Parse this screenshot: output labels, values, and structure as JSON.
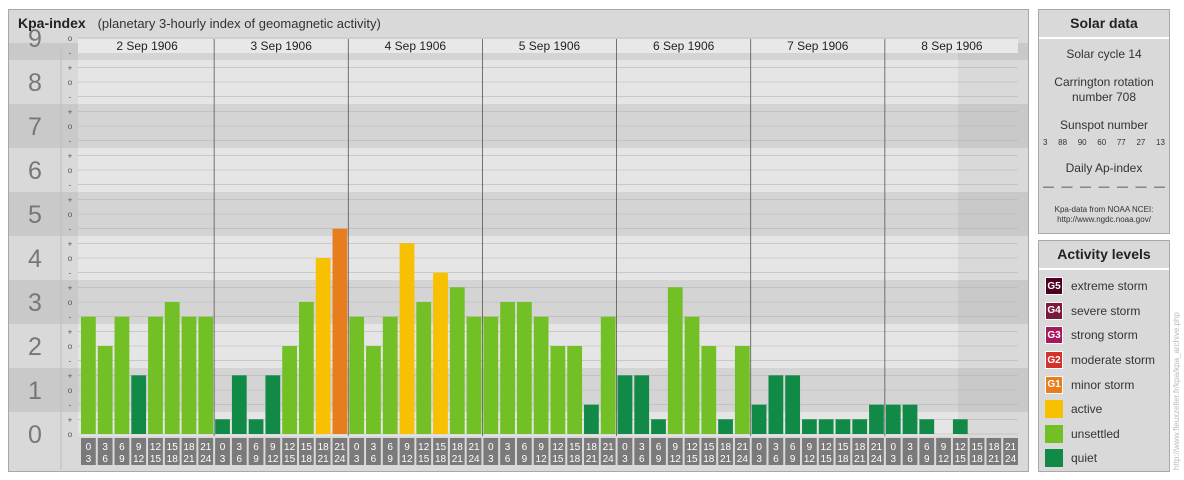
{
  "header": {
    "title": "Kpa-index",
    "subtitle": "(planetary 3-hourly index of geomagnetic activity)"
  },
  "chart_data": {
    "type": "bar",
    "title": "Kpa-index",
    "subtitle": "(planetary 3-hourly index of geomagnetic activity)",
    "ylim": [
      0,
      9
    ],
    "y_ticks": [
      "0",
      "1",
      "2",
      "3",
      "4",
      "5",
      "6",
      "7",
      "8",
      "9"
    ],
    "sub_ticks": [
      "-",
      "o",
      "+"
    ],
    "days": [
      "2 Sep 1906",
      "3 Sep 1906",
      "4 Sep 1906",
      "5 Sep 1906",
      "6 Sep 1906",
      "7 Sep 1906",
      "8 Sep 1906"
    ],
    "interval_starts": [
      "0",
      "3",
      "6",
      "9",
      "12",
      "15",
      "18",
      "21"
    ],
    "interval_ends": [
      "3",
      "6",
      "9",
      "12",
      "15",
      "18",
      "21",
      "24"
    ],
    "values": [
      [
        2.667,
        2.0,
        2.667,
        1.333,
        2.667,
        3.0,
        2.667,
        2.667
      ],
      [
        0.333,
        1.333,
        0.333,
        1.333,
        2.0,
        3.0,
        4.0,
        4.667
      ],
      [
        2.667,
        2.0,
        2.667,
        4.333,
        3.0,
        3.667,
        3.333,
        2.667
      ],
      [
        2.667,
        3.0,
        3.0,
        2.667,
        2.0,
        2.0,
        0.667,
        2.667
      ],
      [
        1.333,
        1.333,
        0.333,
        3.333,
        2.667,
        2.0,
        0.333,
        2.0
      ],
      [
        0.667,
        1.333,
        1.333,
        0.333,
        0.333,
        0.333,
        0.333,
        0.667
      ],
      [
        0.667,
        0.667,
        0.333,
        0.0,
        0.333,
        0.0,
        0.0,
        0.0
      ]
    ],
    "grid": true
  },
  "colors": {
    "extreme": "#4d0022",
    "severe": "#7a1a3f",
    "strong": "#a6195c",
    "moderate": "#d2312c",
    "minor": "#e87d1e",
    "active": "#f7c000",
    "unsettled": "#73bf26",
    "quiet": "#128a47"
  },
  "solar": {
    "title": "Solar data",
    "cycle": "Solar cycle 14",
    "carrington_line1": "Carrington rotation",
    "carrington_line2": "number 708",
    "sunspot_label": "Sunspot number",
    "sunspots": [
      "3",
      "88",
      "90",
      "60",
      "77",
      "27",
      "13"
    ],
    "ap_label": "Daily Ap-index",
    "ap_values": [
      "—",
      "—",
      "—",
      "—",
      "—",
      "—",
      "—"
    ],
    "source_line1": "Kpa-data from NOAA NCEI:",
    "source_line2": "http://www.ngdc.noaa.gov/"
  },
  "levels": {
    "title": "Activity levels",
    "items": [
      {
        "badge": "G5",
        "label": "extreme storm",
        "color": "#4d0022"
      },
      {
        "badge": "G4",
        "label": "severe storm",
        "color": "#7a1a3f"
      },
      {
        "badge": "G3",
        "label": "strong storm",
        "color": "#a6195c"
      },
      {
        "badge": "G2",
        "label": "moderate storm",
        "color": "#d2312c"
      },
      {
        "badge": "G1",
        "label": "minor storm",
        "color": "#e87d1e"
      },
      {
        "badge": "",
        "label": "active",
        "color": "#f7c000"
      },
      {
        "badge": "",
        "label": "unsettled",
        "color": "#73bf26"
      },
      {
        "badge": "",
        "label": "quiet",
        "color": "#128a47"
      }
    ]
  },
  "watermark": "http://www.fleuxzeller.fr/kpa/kpa_archive.php"
}
